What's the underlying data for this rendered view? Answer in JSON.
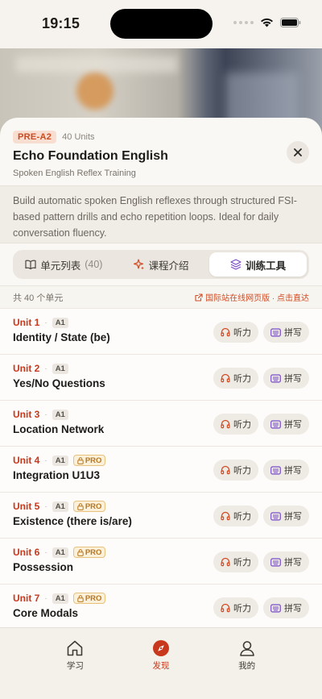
{
  "status": {
    "time": "19:15"
  },
  "course": {
    "level": "PRE-A2",
    "units_count": "40 Units",
    "title": "Echo Foundation English",
    "subtitle": "Spoken English Reflex Training",
    "description": "Build automatic spoken English reflexes through structured FSI-based pattern drills and echo repetition loops. Ideal for daily conversation fluency."
  },
  "tabs": [
    {
      "label": "单元列表",
      "count": "(40)"
    },
    {
      "label": "课程介绍"
    },
    {
      "label": "训练工具",
      "active": true
    }
  ],
  "list_meta": {
    "total": "共 40 个单元",
    "link": "国际站在线网页版 · 点击直达"
  },
  "units": [
    {
      "num": "Unit 1",
      "level": "A1",
      "pro": "",
      "name": "Identity / State (be)"
    },
    {
      "num": "Unit 2",
      "level": "A1",
      "pro": "",
      "name": "Yes/No Questions"
    },
    {
      "num": "Unit 3",
      "level": "A1",
      "pro": "",
      "name": "Location Network"
    },
    {
      "num": "Unit 4",
      "level": "A1",
      "pro": "PRO",
      "name": "Integration U1U3"
    },
    {
      "num": "Unit 5",
      "level": "A1",
      "pro": "PRO",
      "name": "Existence (there is/are)"
    },
    {
      "num": "Unit 6",
      "level": "A1",
      "pro": "PRO",
      "name": "Possession"
    },
    {
      "num": "Unit 7",
      "level": "A1",
      "pro": "PRO",
      "name": "Core Modals"
    }
  ],
  "buttons": {
    "listen": "听力",
    "spell": "拼写"
  },
  "tabbar": [
    {
      "label": "学习",
      "icon": "home-icon"
    },
    {
      "label": "发现",
      "icon": "compass-icon",
      "active": true
    },
    {
      "label": "我的",
      "icon": "person-icon"
    }
  ],
  "colors": {
    "accent": "#c8381c",
    "pro": "#b8761f",
    "purple": "#7a4fc9"
  }
}
